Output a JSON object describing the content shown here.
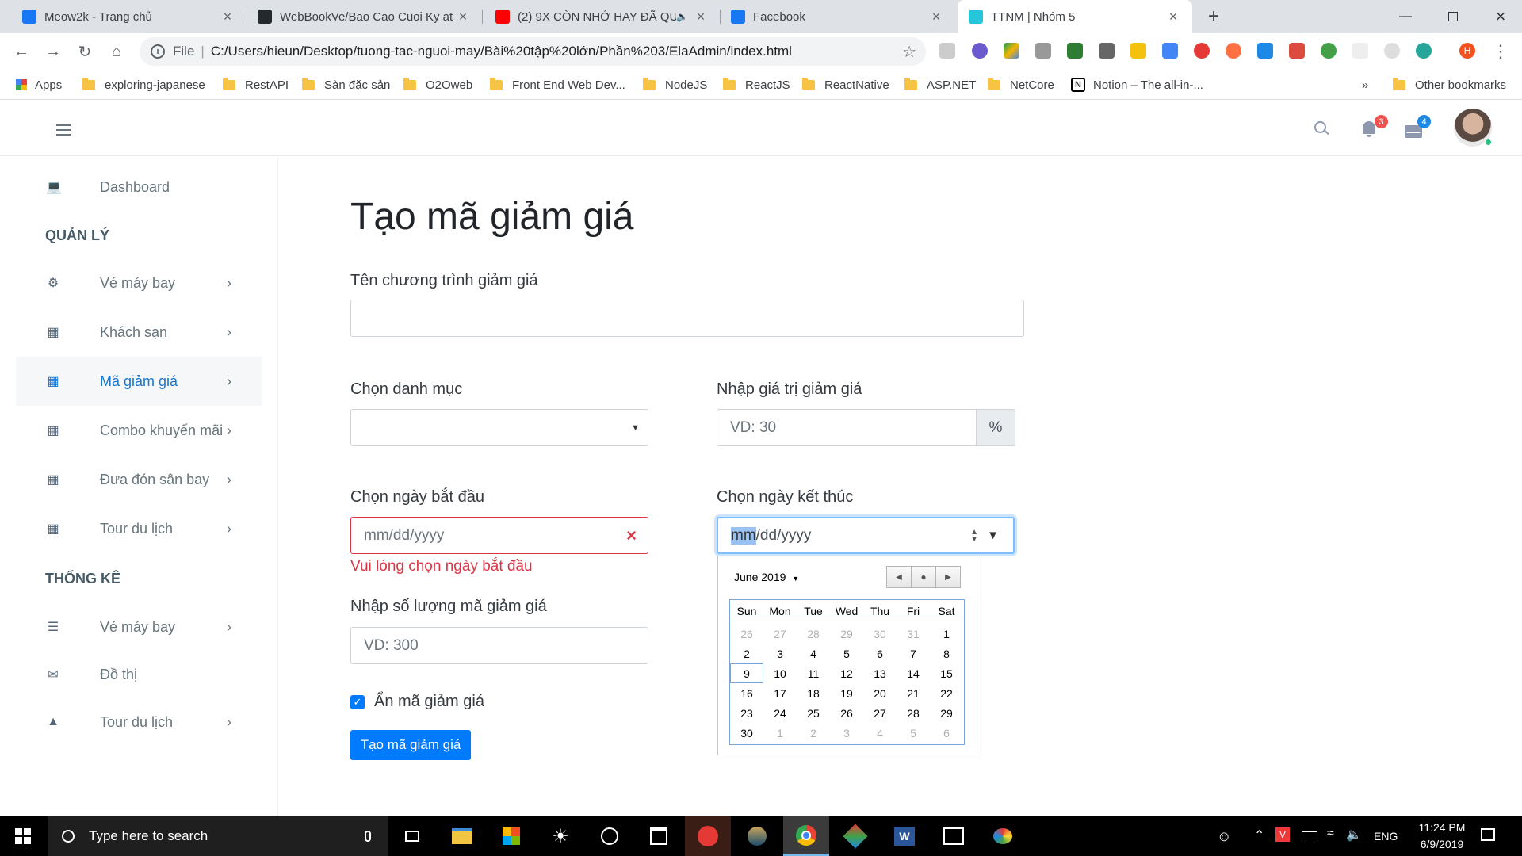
{
  "browser": {
    "tabs": [
      {
        "title": "Meow2k - Trang chủ",
        "favicon": "facebook-icon",
        "color": "#1877f2"
      },
      {
        "title": "WebBookVe/Bao Cao Cuoi Ky at",
        "favicon": "github-icon",
        "color": "#24292e"
      },
      {
        "title": "(2) 9X CÒN NHỚ HAY ĐÃ QU",
        "favicon": "youtube-icon",
        "color": "#ff0000"
      },
      {
        "title": "Facebook",
        "favicon": "facebook-icon",
        "color": "#1877f2"
      },
      {
        "title": "TTNM | Nhóm 5",
        "favicon": "ela-icon",
        "color": "#26c6da"
      }
    ],
    "address": {
      "scheme": "File",
      "url": "C:/Users/hieun/Desktop/tuong-tac-nguoi-may/Bài%20tập%20lớn/Phần%203/ElaAdmin/index.html"
    },
    "bookmarks": [
      "Apps",
      "exploring-japanese",
      "RestAPI",
      "Sàn đặc sản",
      "O2Oweb",
      "Front End Web Dev...",
      "NodeJS",
      "ReactJS",
      "ReactNative",
      "ASP.NET",
      "NetCore",
      "Notion – The all-in-...",
      "»",
      "Other bookmarks"
    ],
    "profile_initial": "H"
  },
  "header": {
    "notification_count": "3",
    "message_count": "4"
  },
  "sidebar": {
    "dashboard": "Dashboard",
    "section1": "QUẢN LÝ",
    "items1": [
      "Vé máy bay",
      "Khách sạn",
      "Mã giảm giá",
      "Combo khuyến mãi",
      "Đưa đón sân bay",
      "Tour du lịch"
    ],
    "section2": "THỐNG KÊ",
    "items2": [
      "Vé máy bay",
      "Đồ thị",
      "Tour du lịch"
    ]
  },
  "form": {
    "title": "Tạo mã giảm giá",
    "name_label": "Tên chương trình giảm giá",
    "category_label": "Chọn danh mục",
    "value_label": "Nhập giá trị giảm giá",
    "value_placeholder": "VD: 30",
    "value_unit": "%",
    "start_label": "Chọn ngày bắt đầu",
    "start_placeholder": "mm/dd/yyyy",
    "start_error": "Vui lòng chọn ngày bắt đầu",
    "end_label": "Chọn ngày kết thúc",
    "end_placeholder_mm": "mm",
    "end_placeholder_rest": "/dd/yyyy",
    "quantity_label": "Nhập số lượng mã giảm giá",
    "quantity_placeholder": "VD: 300",
    "hide_label": "Ẩn mã giảm giá",
    "hide_checked": true,
    "submit": "Tạo mã giảm giá"
  },
  "calendar": {
    "month_label": "June 2019",
    "weekdays": [
      "Sun",
      "Mon",
      "Tue",
      "Wed",
      "Thu",
      "Fri",
      "Sat"
    ],
    "weeks": [
      [
        "26",
        "27",
        "28",
        "29",
        "30",
        "31",
        "1"
      ],
      [
        "2",
        "3",
        "4",
        "5",
        "6",
        "7",
        "8"
      ],
      [
        "9",
        "10",
        "11",
        "12",
        "13",
        "14",
        "15"
      ],
      [
        "16",
        "17",
        "18",
        "19",
        "20",
        "21",
        "22"
      ],
      [
        "23",
        "24",
        "25",
        "26",
        "27",
        "28",
        "29"
      ],
      [
        "30",
        "1",
        "2",
        "3",
        "4",
        "5",
        "6"
      ]
    ],
    "today": "9"
  },
  "taskbar": {
    "search_placeholder": "Type here to search",
    "lang": "ENG",
    "time": "11:24 PM",
    "date": "6/9/2019"
  }
}
